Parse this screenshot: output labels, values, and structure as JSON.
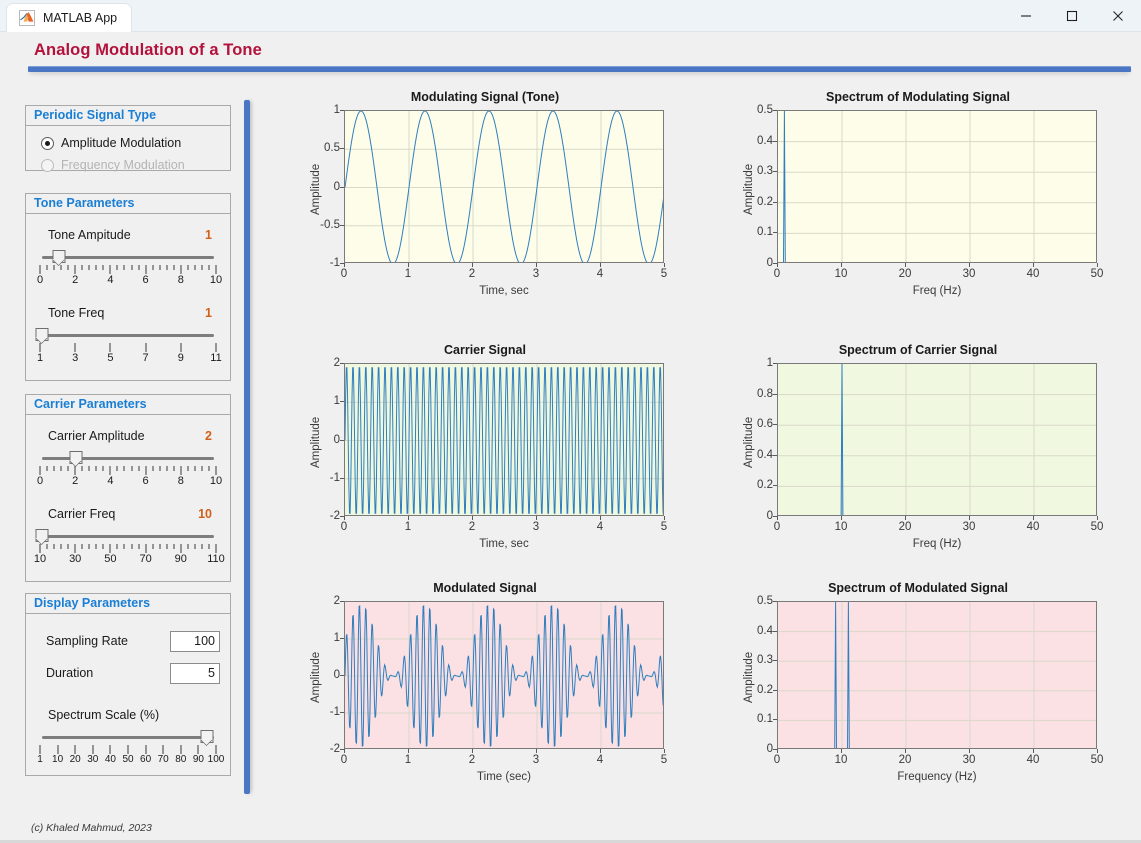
{
  "window": {
    "title": "MATLAB App",
    "app_icon": "matlab-icon",
    "minimize_label": "Minimize",
    "maximize_label": "Maximize",
    "close_label": "Close"
  },
  "header": {
    "title": "Analog Modulation of a Tone",
    "accent": "#b3123c",
    "rule_color": "#4a76c4"
  },
  "footer": {
    "copyright": "(c) Khaled Mahmud, 2023"
  },
  "panels": {
    "signal_type": {
      "title": "Periodic Signal Type",
      "options": [
        {
          "label": "Amplitude Modulation",
          "selected": true,
          "enabled": true
        },
        {
          "label": "Frequency Modulation",
          "selected": false,
          "enabled": false
        }
      ]
    },
    "tone": {
      "title": "Tone Parameters",
      "sliders": [
        {
          "label": "Tone Ampitude",
          "value": "1",
          "pos_pct": 10,
          "tick_labels": [
            "0",
            "2",
            "4",
            "6",
            "8",
            "10"
          ],
          "minor_per_major": 4
        },
        {
          "label": "Tone Freq",
          "value": "1",
          "pos_pct": 0,
          "tick_labels": [
            "1",
            "3",
            "5",
            "7",
            "9",
            "11"
          ],
          "minor_per_major": 0
        }
      ]
    },
    "carrier": {
      "title": "Carrier Parameters",
      "sliders": [
        {
          "label": "Carrier Amplitude",
          "value": "2",
          "pos_pct": 20,
          "tick_labels": [
            "0",
            "2",
            "4",
            "6",
            "8",
            "10"
          ],
          "minor_per_major": 4
        },
        {
          "label": "Carrier Freq",
          "value": "10",
          "pos_pct": 0,
          "tick_labels": [
            "10",
            "30",
            "50",
            "70",
            "90",
            "110"
          ],
          "minor_per_major": 4
        }
      ]
    },
    "display": {
      "title": "Display Parameters",
      "fields": [
        {
          "label": "Sampling Rate",
          "value": "100"
        },
        {
          "label": "Duration",
          "value": "5"
        }
      ],
      "spectrum_scale": {
        "label": "Spectrum Scale (%)",
        "value": "100",
        "pos_pct": 96,
        "tick_labels": [
          "1",
          "10",
          "20",
          "30",
          "40",
          "50",
          "60",
          "70",
          "80",
          "90",
          "100"
        ]
      }
    }
  },
  "accent_value_color": "#d2601a",
  "panel_title_color": "#1a7fd4",
  "chart_data": [
    {
      "id": "modulating-signal",
      "type": "line",
      "title": "Modulating Signal (Tone)",
      "xlabel": "Time, sec",
      "ylabel": "Amplitude",
      "xlim": [
        0,
        5
      ],
      "ylim": [
        -1,
        1
      ],
      "xticks": [
        0,
        1,
        2,
        3,
        4,
        5
      ],
      "yticks": [
        -1,
        -0.5,
        0,
        0.5,
        1
      ],
      "ytick_labels": [
        "-1",
        "-0.5",
        "0",
        "0.5",
        "1"
      ],
      "bg": "#fdfdea",
      "grid": true,
      "wave": {
        "kind": "sine",
        "amplitude": 1,
        "frequency": 1,
        "offset": 0
      }
    },
    {
      "id": "spectrum-modulating-signal",
      "type": "line",
      "title": "Spectrum of Modulating Signal",
      "xlabel": "Freq (Hz)",
      "ylabel": "Amplitude",
      "xlim": [
        0,
        50
      ],
      "ylim": [
        0,
        0.5
      ],
      "xticks": [
        0,
        10,
        20,
        30,
        40,
        50
      ],
      "yticks": [
        0,
        0.1,
        0.2,
        0.3,
        0.4,
        0.5
      ],
      "ytick_labels": [
        "0",
        "0.1",
        "0.2",
        "0.3",
        "0.4",
        "0.5"
      ],
      "bg": "#fdfdea",
      "grid": true,
      "spikes": [
        {
          "freq": 1,
          "amplitude": 0.5
        }
      ]
    },
    {
      "id": "carrier-signal",
      "type": "line",
      "title": "Carrier Signal",
      "xlabel": "Time, sec",
      "ylabel": "Amplitude",
      "xlim": [
        0,
        5
      ],
      "ylim": [
        -2,
        2
      ],
      "xticks": [
        0,
        1,
        2,
        3,
        4,
        5
      ],
      "yticks": [
        -2,
        -1,
        0,
        1,
        2
      ],
      "ytick_labels": [
        "-2",
        "-1",
        "0",
        "1",
        "2"
      ],
      "bg": "#f1f8e0",
      "grid": true,
      "wave": {
        "kind": "sine",
        "amplitude": 2,
        "frequency": 10,
        "offset": 0
      }
    },
    {
      "id": "spectrum-carrier-signal",
      "type": "line",
      "title": "Spectrum of Carrier Signal",
      "xlabel": "Freq (Hz)",
      "ylabel": "Amplitude",
      "xlim": [
        0,
        50
      ],
      "ylim": [
        0,
        1
      ],
      "xticks": [
        0,
        10,
        20,
        30,
        40,
        50
      ],
      "yticks": [
        0,
        0.2,
        0.4,
        0.6,
        0.8,
        1
      ],
      "ytick_labels": [
        "0",
        "0.2",
        "0.4",
        "0.6",
        "0.8",
        "1"
      ],
      "bg": "#f1f8e0",
      "grid": true,
      "spikes": [
        {
          "freq": 10,
          "amplitude": 1
        }
      ]
    },
    {
      "id": "modulated-signal",
      "type": "line",
      "title": "Modulated Signal",
      "xlabel": "Time (sec)",
      "ylabel": "Amplitude",
      "xlim": [
        0,
        5
      ],
      "ylim": [
        -2,
        2
      ],
      "xticks": [
        0,
        1,
        2,
        3,
        4,
        5
      ],
      "yticks": [
        -2,
        -1,
        0,
        1,
        2
      ],
      "ytick_labels": [
        "-2",
        "-1",
        "0",
        "1",
        "2"
      ],
      "bg": "#fbe0e4",
      "grid": true,
      "wave": {
        "kind": "am",
        "amplitude": 1,
        "frequency": 10,
        "mod_frequency": 1,
        "mod_index": 1
      }
    },
    {
      "id": "spectrum-modulated-signal",
      "type": "line",
      "title": "Spectrum of Modulated Signal",
      "xlabel": "Frequency (Hz)",
      "ylabel": "Amplitude",
      "xlim": [
        0,
        50
      ],
      "ylim": [
        0,
        0.5
      ],
      "xticks": [
        0,
        10,
        20,
        30,
        40,
        50
      ],
      "yticks": [
        0,
        0.1,
        0.2,
        0.3,
        0.4,
        0.5
      ],
      "ytick_labels": [
        "0",
        "0.1",
        "0.2",
        "0.3",
        "0.4",
        "0.5"
      ],
      "bg": "#fbe0e4",
      "grid": true,
      "spikes": [
        {
          "freq": 9,
          "amplitude": 0.5
        },
        {
          "freq": 11,
          "amplitude": 0.5
        }
      ]
    }
  ]
}
